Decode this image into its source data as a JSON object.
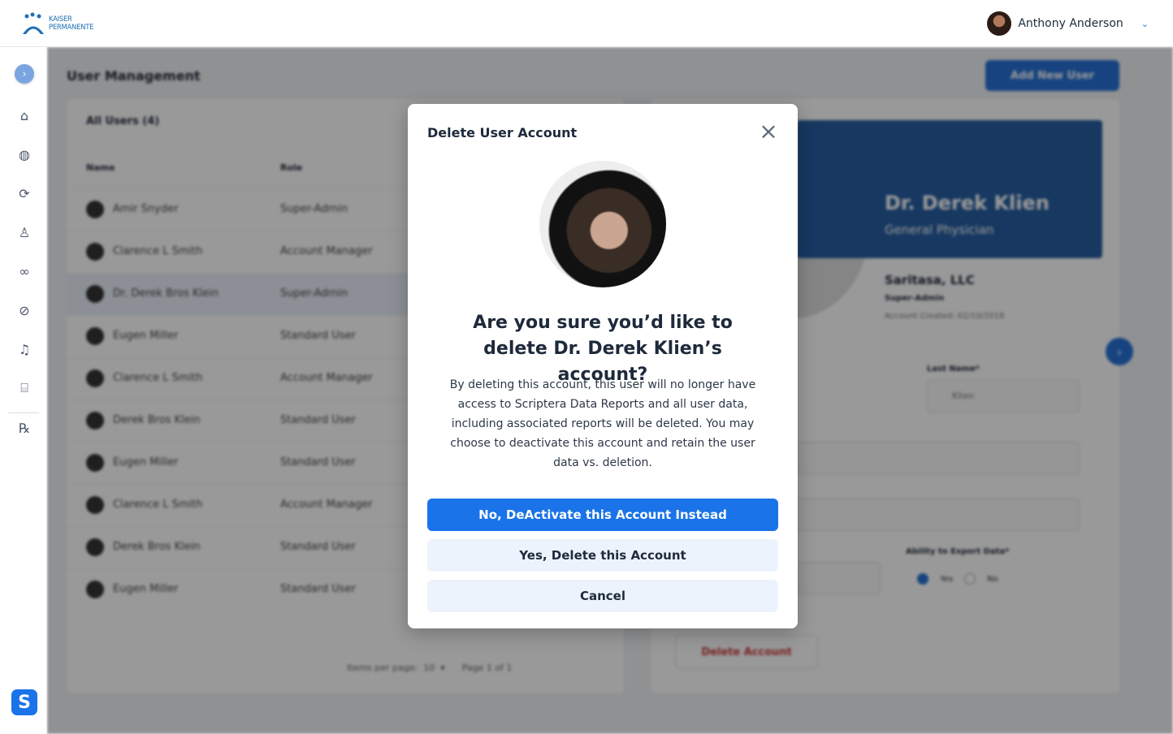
{
  "header": {
    "logo_line1": "KAISER",
    "logo_line2": "PERMANENTE",
    "user_name": "Anthony Anderson"
  },
  "sidebar": {
    "items": [
      {
        "icon": "home-icon",
        "symbol": "⌂"
      },
      {
        "icon": "globe-icon",
        "symbol": "◍"
      },
      {
        "icon": "sync-icon",
        "symbol": "⟳"
      },
      {
        "icon": "doctor-icon",
        "symbol": "♙"
      },
      {
        "icon": "binoculars-icon",
        "symbol": "∞"
      },
      {
        "icon": "pills-icon",
        "symbol": "⊘"
      },
      {
        "icon": "bell-alert-icon",
        "symbol": "♫"
      },
      {
        "icon": "bank-icon",
        "symbol": "⌸"
      },
      {
        "icon": "rx-icon",
        "symbol": "℞"
      }
    ],
    "brand_letter": "S"
  },
  "background": {
    "page_title": "User Management",
    "add_button": "Add New User",
    "table_title": "All Users  (4)",
    "col_name": "Name",
    "col_role": "Role",
    "rows": [
      {
        "name": "Amir Snyder",
        "role": "Super-Admin"
      },
      {
        "name": "Clarence L Smith",
        "role": "Account Manager"
      },
      {
        "name": "Dr. Derek Bros Klein",
        "role": "Super-Admin"
      },
      {
        "name": "Eugen Miller",
        "role": "Standard User"
      },
      {
        "name": "Clarence L Smith",
        "role": "Account Manager"
      },
      {
        "name": "Derek Bros Klein",
        "role": "Standard User"
      },
      {
        "name": "Eugen Miller",
        "role": "Standard User"
      },
      {
        "name": "Clarence L Smith",
        "role": "Account Manager"
      },
      {
        "name": "Derek Bros Klein",
        "role": "Standard User"
      },
      {
        "name": "Eugen Miller",
        "role": "Standard User"
      }
    ],
    "pager": "Items per page:  10  ▾      Page 1 of 1",
    "profile_name": "Dr. Derek Klien",
    "profile_title": "General Physician",
    "company": "Saritasa, LLC",
    "role": "Super-Admin",
    "created": "Account Created: 02/10/2018",
    "last_name_label": "Last Name*",
    "last_name_value": "Klien",
    "export_label": "Ability to Export Data*",
    "yes": "Yes",
    "no": "No",
    "delete_button": "Delete Account"
  },
  "modal": {
    "title": "Delete User Account",
    "heading": "Are you sure you’d like to delete Dr. Derek Klien’s account?",
    "body": "By deleting this account, this user will no longer have access to Scriptera Data Reports and all user data, including associated reports will be deleted. You may choose to deactivate this account and retain the user data vs. deletion.",
    "deactivate_button": "No, DeActivate this Account Instead",
    "delete_button": "Yes, Delete this Account",
    "cancel_button": "Cancel"
  },
  "colors": {
    "primary": "#1a73e8",
    "secondary_button": "#edf3fc"
  }
}
